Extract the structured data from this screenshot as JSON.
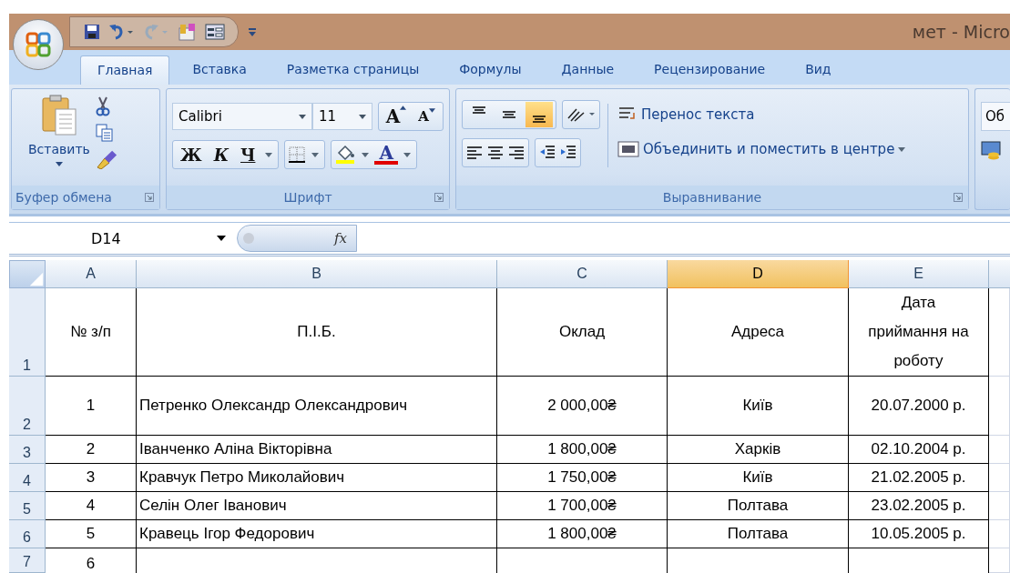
{
  "window": {
    "title": "мет - Micro"
  },
  "tabs": [
    {
      "label": "Главная",
      "selected": true
    },
    {
      "label": "Вставка",
      "selected": false
    },
    {
      "label": "Разметка страницы",
      "selected": false
    },
    {
      "label": "Формулы",
      "selected": false
    },
    {
      "label": "Данные",
      "selected": false
    },
    {
      "label": "Рецензирование",
      "selected": false
    },
    {
      "label": "Вид",
      "selected": false
    }
  ],
  "clipboard": {
    "paste": "Вставить",
    "group": "Буфер обмена"
  },
  "font": {
    "name": "Calibri",
    "size": "11",
    "grow": "A",
    "shrink": "A",
    "bold": "Ж",
    "italic": "К",
    "underline": "Ч",
    "color_letter": "A",
    "group": "Шрифт"
  },
  "alignment": {
    "vertical": [
      {
        "selected": false
      },
      {
        "selected": false
      },
      {
        "selected": true
      }
    ],
    "wrap": "Перенос текста",
    "merge": "Объединить и поместить в центре",
    "group": "Выравнивание"
  },
  "number": {
    "format": "Об"
  },
  "formula_bar": {
    "name_box": "D14",
    "function_label": "fx"
  },
  "columns": [
    {
      "label": "A",
      "selected": false
    },
    {
      "label": "B",
      "selected": false
    },
    {
      "label": "C",
      "selected": false
    },
    {
      "label": "D",
      "selected": true
    },
    {
      "label": "E",
      "selected": false
    }
  ],
  "rows": [
    {
      "number": "1",
      "cells": [
        "№ з/п",
        "П.І.Б.",
        "Оклад",
        "Адреса",
        "Дата приймання на роботу"
      ]
    },
    {
      "number": "2",
      "cells": [
        "1",
        "Петренко Олександр Олександрович",
        "2 000,00₴",
        "Київ",
        "20.07.2000 р."
      ]
    },
    {
      "number": "3",
      "cells": [
        "2",
        "Іванченко Аліна Вікторівна",
        "1 800,00₴",
        "Харків",
        "02.10.2004 р."
      ]
    },
    {
      "number": "4",
      "cells": [
        "3",
        "Кравчук Петро Миколайович",
        "1 750,00₴",
        "Київ",
        "21.02.2005 р."
      ]
    },
    {
      "number": "5",
      "cells": [
        "4",
        "Селін Олег Іванович",
        "1 700,00₴",
        "Полтава",
        "23.02.2005 р."
      ]
    },
    {
      "number": "6",
      "cells": [
        "5",
        "Кравець Ігор Федорович",
        "1 800,00₴",
        "Полтава",
        "10.05.2005 р."
      ]
    },
    {
      "number": "7",
      "cells": [
        "6",
        "",
        "",
        "",
        ""
      ]
    }
  ]
}
